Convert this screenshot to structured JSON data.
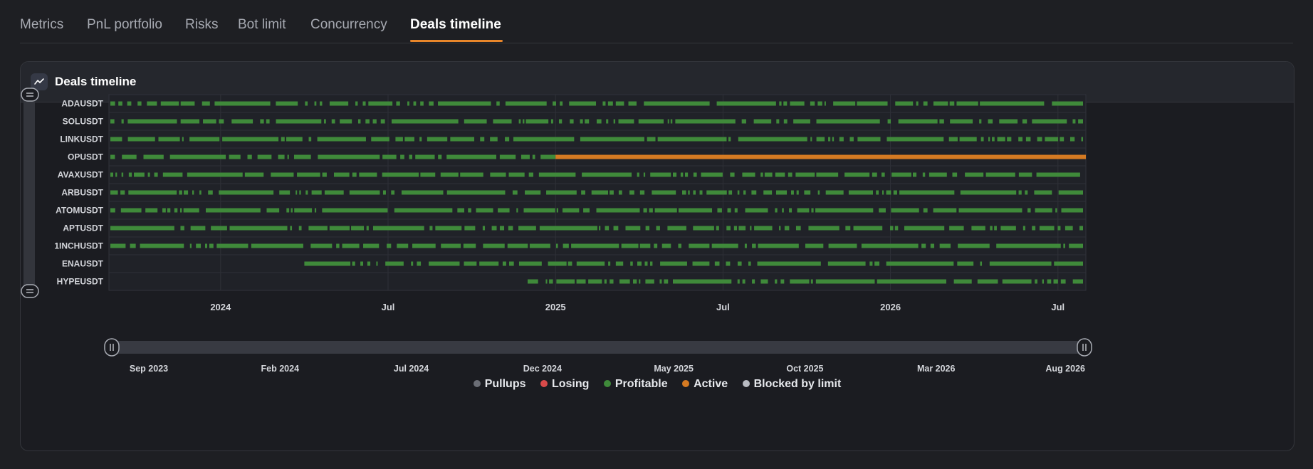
{
  "tabs": [
    {
      "label": "Metrics",
      "active": false
    },
    {
      "label": "PnL portfolio",
      "active": false
    },
    {
      "label": "Risks",
      "active": false
    },
    {
      "label": "Bot limit",
      "active": false
    },
    {
      "label": "Concurrency",
      "active": false
    },
    {
      "label": "Deals timeline",
      "active": true
    }
  ],
  "card": {
    "title": "Deals timeline",
    "icon": "line-chart-icon"
  },
  "colors": {
    "profitable": "#3f8a3a",
    "active": "#d57a22",
    "losing": "#d94a4a",
    "pullups": "#6b6e76",
    "blocked": "#b8bbc2",
    "accent": "#e8862a"
  },
  "chart_data": {
    "type": "timeline",
    "title": "Deals timeline",
    "x_range": [
      "2023-09",
      "2026-08"
    ],
    "x_ticks": [
      "2024",
      "Jul",
      "2025",
      "Jul",
      "2026",
      "Jul"
    ],
    "symbols": [
      "ADAUSDT",
      "SOLUSDT",
      "LINKUSDT",
      "OPUSDT",
      "AVAXUSDT",
      "ARBUSDT",
      "ATOMUSDT",
      "APTUSDT",
      "1INCHUSDT",
      "ENAUSDT",
      "HYPEUSDT"
    ],
    "series": [
      {
        "name": "ADAUSDT",
        "active_from": null
      },
      {
        "name": "SOLUSDT",
        "active_from": null
      },
      {
        "name": "LINKUSDT",
        "active_from": null
      },
      {
        "name": "OPUSDT",
        "active_from": "2025-01"
      },
      {
        "name": "AVAXUSDT",
        "active_from": null
      },
      {
        "name": "ARBUSDT",
        "active_from": null
      },
      {
        "name": "ATOMUSDT",
        "active_from": null
      },
      {
        "name": "APTUSDT",
        "active_from": null
      },
      {
        "name": "1INCHUSDT",
        "active_from": null
      },
      {
        "name": "ENAUSDT",
        "active_from": null
      },
      {
        "name": "HYPEUSDT",
        "active_from": null
      }
    ],
    "legend": [
      "Pullups",
      "Losing",
      "Profitable",
      "Active",
      "Blocked by limit"
    ],
    "legend_colors": [
      "#6b6e76",
      "#d94a4a",
      "#3f8a3a",
      "#d57a22",
      "#b8bbc2"
    ],
    "navigator_ticks": [
      "Sep 2023",
      "Feb 2024",
      "Jul 2024",
      "Dec 2024",
      "May 2025",
      "Oct 2025",
      "Mar 2026",
      "Aug 2026"
    ],
    "grid": true
  }
}
